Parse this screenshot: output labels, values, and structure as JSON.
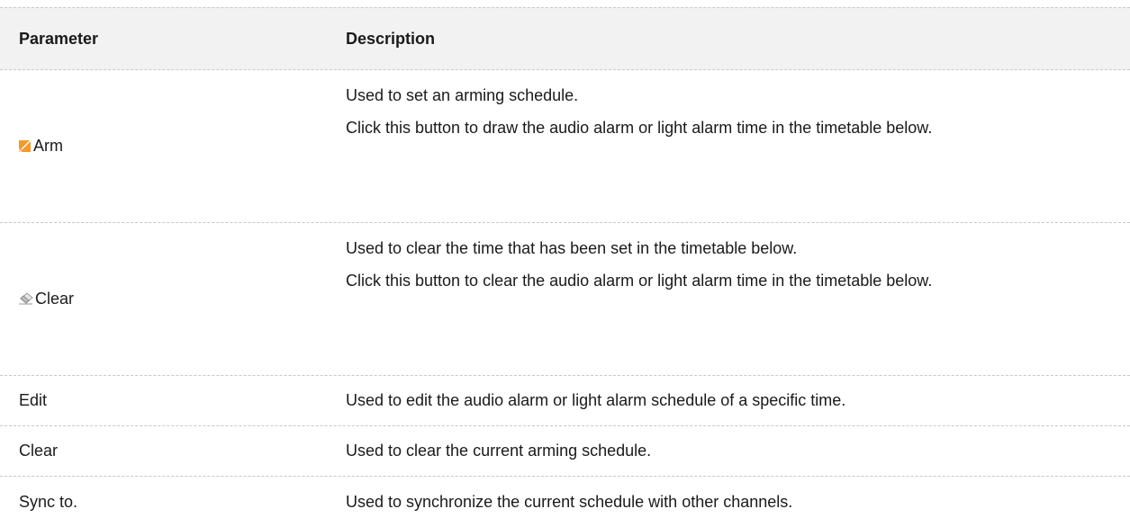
{
  "table": {
    "header": {
      "parameter": "Parameter",
      "description": "Description"
    },
    "rows": [
      {
        "icon": "pencil-icon",
        "parameter": "Arm",
        "descriptions": [
          "Used to set an arming schedule.",
          "Click this button to draw the audio alarm or light alarm time in the timetable below."
        ]
      },
      {
        "icon": "eraser-icon",
        "parameter": "Clear",
        "descriptions": [
          "Used to clear the time that has been set in the timetable below.",
          "Click this button to clear the audio alarm or light alarm time in the timetable below."
        ]
      },
      {
        "parameter": "Edit",
        "descriptions": [
          "Used to edit the audio alarm or light alarm schedule of a specific time."
        ]
      },
      {
        "parameter": "Clear",
        "descriptions": [
          "Used to clear the current arming schedule."
        ]
      },
      {
        "parameter": "Sync to.",
        "descriptions": [
          "Used to synchronize the current schedule with other channels."
        ]
      }
    ]
  },
  "colors": {
    "header_bg": "#f2f2f2",
    "pencil_accent": "#f39a2b",
    "divider": "#c8c8c8"
  }
}
